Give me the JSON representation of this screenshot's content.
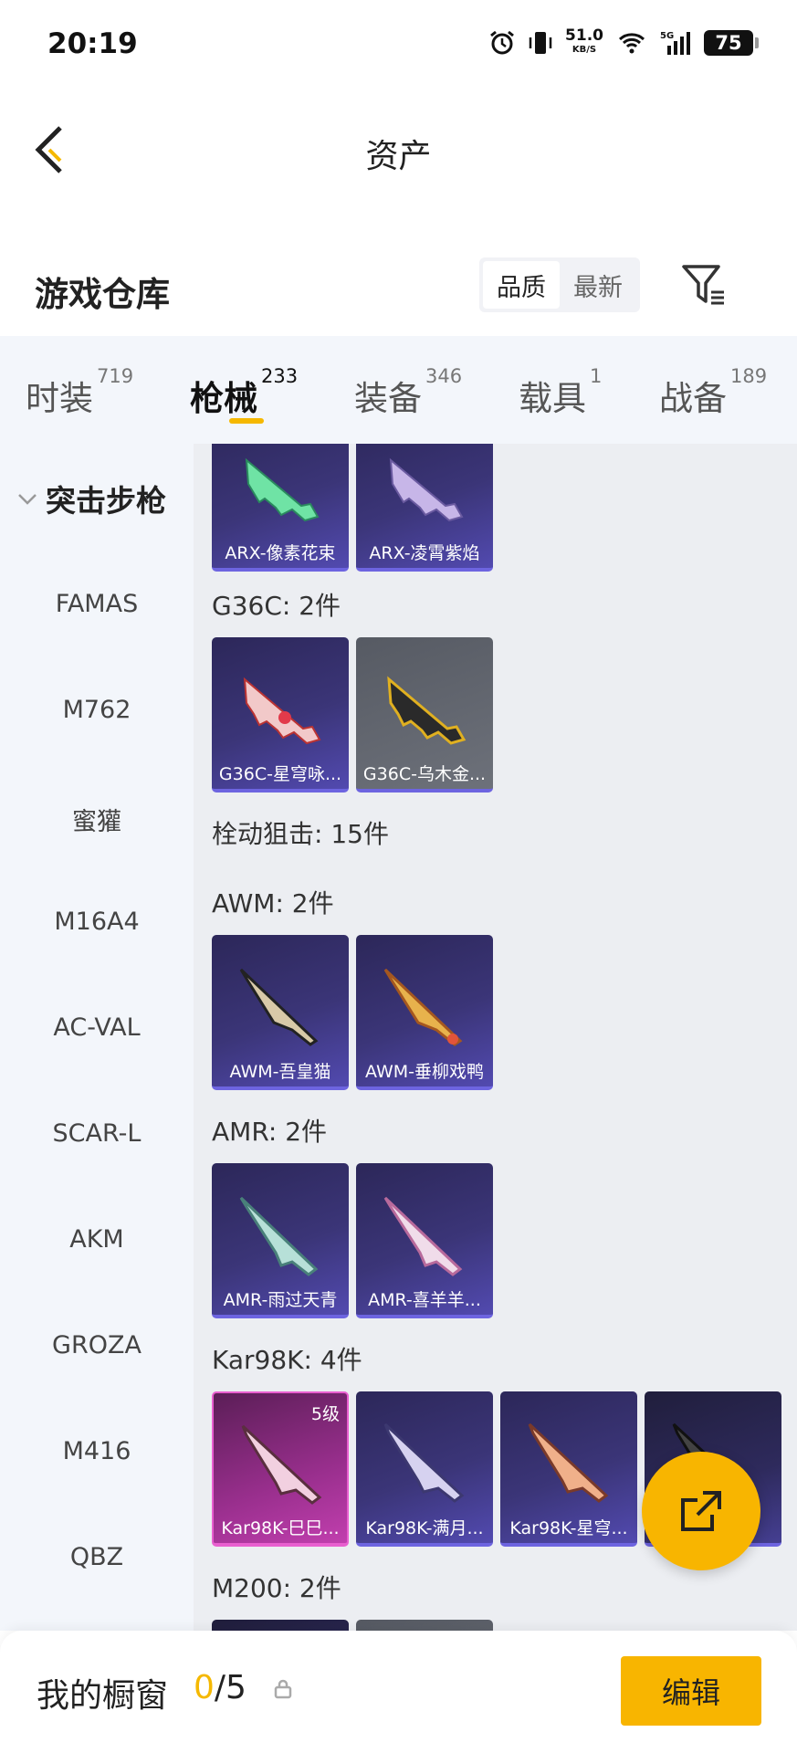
{
  "status_bar": {
    "time": "20:19",
    "net_speed": "51.0",
    "net_unit": "KB/S",
    "battery": "75",
    "icons": [
      "alarm-icon",
      "vibrate-icon",
      "wifi-icon",
      "signal-5g-icon"
    ]
  },
  "header": {
    "title": "资产",
    "back_icon": "back-icon"
  },
  "warehouse": {
    "title": "游戏仓库",
    "sort": [
      "品质",
      "最新"
    ],
    "filter_icon": "filter-icon"
  },
  "tabs": [
    {
      "label": "时装",
      "count": "719"
    },
    {
      "label": "枪械",
      "count": "233"
    },
    {
      "label": "装备",
      "count": "346"
    },
    {
      "label": "载具",
      "count": "1"
    },
    {
      "label": "战备",
      "count": "189"
    }
  ],
  "side": {
    "category": "突击步枪",
    "items": [
      "FAMAS",
      "M762",
      "蜜獾",
      "M16A4",
      "AC-VAL",
      "SCAR-L",
      "AKM",
      "GROZA",
      "M416",
      "QBZ"
    ]
  },
  "content": {
    "top_cards": [
      "ARX-像素花束",
      "ARX-凌霄紫焰"
    ],
    "groups": [
      {
        "title": "G36C: 2件",
        "cards": [
          "G36C-星穹咏...",
          "G36C-乌木金..."
        ]
      },
      {
        "title": "栓动狙击: 15件"
      },
      {
        "title": "AWM: 2件",
        "cards": [
          "AWM-吾皇猫",
          "AWM-垂柳戏鸭"
        ]
      },
      {
        "title": "AMR: 2件",
        "cards": [
          "AMR-雨过天青",
          "AMR-喜羊羊..."
        ]
      },
      {
        "title": "Kar98K: 4件",
        "cards": [
          "Kar98K-巳巳...",
          "Kar98K-满月...",
          "Kar98K-星穹...",
          ""
        ],
        "level": "5级"
      },
      {
        "title": "M200: 2件"
      }
    ]
  },
  "bottom": {
    "showcase_label": "我的橱窗",
    "showcase_current": "0",
    "showcase_total": "/5",
    "edit_label": "编辑"
  },
  "colors": {
    "accent": "#f8b500",
    "card_purple": "#3b3578",
    "card_pink": "#9a2f8e"
  }
}
